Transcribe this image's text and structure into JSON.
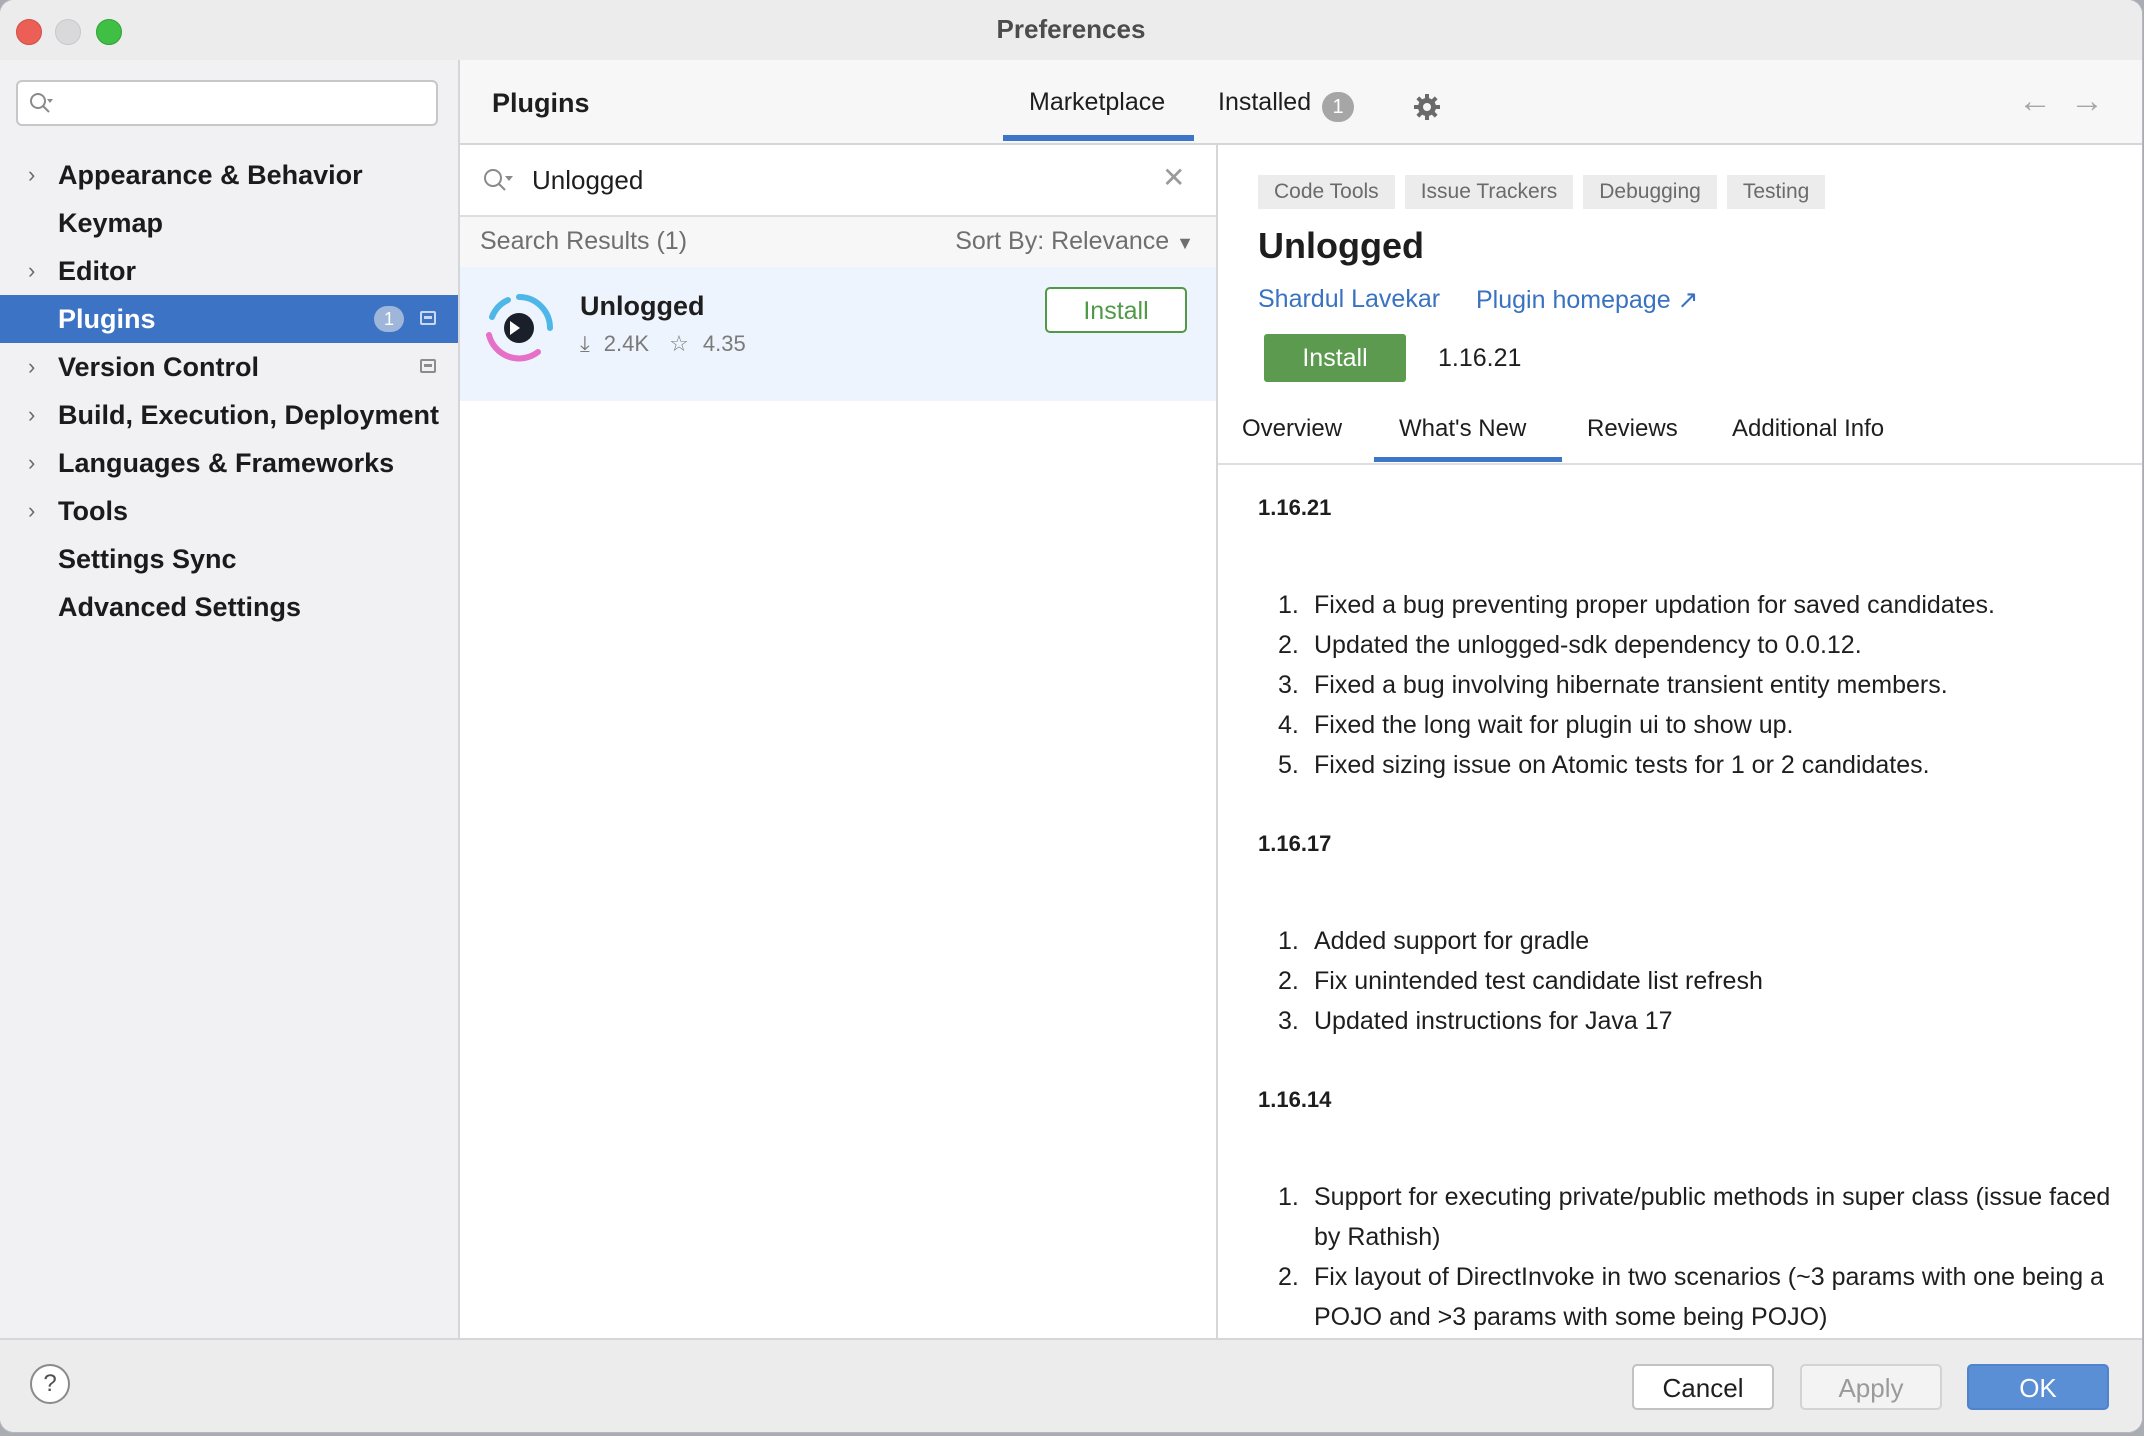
{
  "window": {
    "title": "Preferences"
  },
  "sidebar": {
    "search_value": "",
    "items": [
      {
        "label": "Appearance & Behavior",
        "expandable": true
      },
      {
        "label": "Keymap",
        "expandable": false
      },
      {
        "label": "Editor",
        "expandable": true
      },
      {
        "label": "Plugins",
        "expandable": false,
        "selected": true,
        "badge": "1"
      },
      {
        "label": "Version Control",
        "expandable": true
      },
      {
        "label": "Build, Execution, Deployment",
        "expandable": true
      },
      {
        "label": "Languages & Frameworks",
        "expandable": true
      },
      {
        "label": "Tools",
        "expandable": true
      },
      {
        "label": "Settings Sync",
        "expandable": false
      },
      {
        "label": "Advanced Settings",
        "expandable": false
      }
    ]
  },
  "header": {
    "title": "Plugins",
    "tabs": {
      "marketplace": "Marketplace",
      "installed": "Installed",
      "installed_count": "1"
    },
    "back_icon": "arrow-left-icon",
    "forward_icon": "arrow-right-icon"
  },
  "search": {
    "value": "Unlogged",
    "results_label": "Search Results (1)",
    "sort_label": "Sort By: Relevance"
  },
  "result": {
    "name": "Unlogged",
    "downloads": "2.4K",
    "rating": "4.35",
    "install_label": "Install"
  },
  "detail": {
    "tags": [
      "Code Tools",
      "Issue Trackers",
      "Debugging",
      "Testing"
    ],
    "title": "Unlogged",
    "vendor": "Shardul Lavekar",
    "homepage": "Plugin homepage ↗",
    "install_label": "Install",
    "version": "1.16.21",
    "tabs": [
      "Overview",
      "What's New",
      "Reviews",
      "Additional Info"
    ],
    "active_tab": "What's New",
    "releases": [
      {
        "version": "1.16.21",
        "notes": [
          "Fixed a bug preventing proper updation for saved candidates.",
          "Updated the unlogged-sdk dependency to 0.0.12.",
          "Fixed a bug involving hibernate transient entity members.",
          "Fixed the long wait for plugin ui to show up.",
          "Fixed sizing issue on Atomic tests for 1 or 2 candidates."
        ]
      },
      {
        "version": "1.16.17",
        "notes": [
          "Added support for gradle",
          "Fix unintended test candidate list refresh",
          "Updated instructions for Java 17"
        ]
      },
      {
        "version": "1.16.14",
        "notes": [
          "Support for executing private/public methods in super class (issue faced by Rathish)",
          "Fix layout of DirectInvoke in two scenarios (~3 params with one being a POJO and >3 params with some being POJO)"
        ]
      }
    ]
  },
  "footer": {
    "help": "?",
    "cancel": "Cancel",
    "apply": "Apply",
    "ok": "OK"
  },
  "colors": {
    "selection": "#3c73c4",
    "accent_tab": "#3d76c8",
    "install_green": "#5c9b4f",
    "link": "#3872c1",
    "ok_button": "#5a8fd6"
  }
}
